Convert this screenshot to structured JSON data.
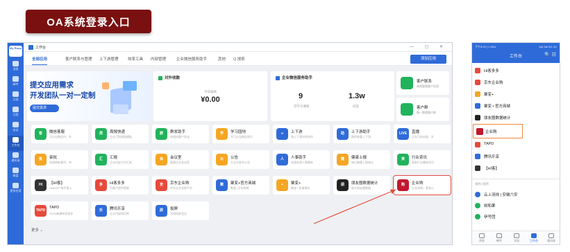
{
  "slide_title": "OA系统登录入口",
  "desktop": {
    "logo_text": "My Roup",
    "window_title": "工作台",
    "window_controls": "— ▢ ✕",
    "rail": [
      {
        "label": "消息",
        "icon": "chat-icon"
      },
      {
        "label": "邮件",
        "icon": "mail-icon"
      },
      {
        "label": "文档",
        "icon": "doc-icon"
      },
      {
        "label": "日程",
        "icon": "calendar-icon"
      },
      {
        "label": "会议",
        "icon": "meeting-icon"
      },
      {
        "label": "工作台",
        "icon": "grid-icon",
        "active": true
      },
      {
        "label": "通讯录",
        "icon": "contacts-icon"
      },
      {
        "label": "微盘",
        "icon": "disk-icon"
      },
      {
        "label": "更多应用",
        "icon": "apps-icon"
      }
    ],
    "tabs": [
      "全部应用",
      "客户联系与管理",
      "上下游管理",
      "效率工具",
      "内部管理",
      "企业微信服务助手",
      "其他"
    ],
    "search_label": "Q 搜索",
    "add_app_label": "添加应用",
    "banner": {
      "line1": "提交应用需求",
      "line2": "开发团队一对一定制",
      "button": "提交需求"
    },
    "card_receipts": {
      "title": "对外收款",
      "label": "今日收款",
      "value": "¥0.00"
    },
    "card_service": {
      "title": "企业微信服务助手",
      "v1": "9",
      "l1": "可学习课程",
      "v2": "1.3w",
      "l2": "问答"
    },
    "side_items": [
      {
        "name": "客户联系",
        "desc": "高效管理客户信息"
      },
      {
        "name": "客户群",
        "desc": "统一管理客户群"
      }
    ],
    "apps": [
      {
        "name": "微信客服",
        "desc": "可以在微信内、外",
        "color": "#21b35c",
        "glyph": "客"
      },
      {
        "name": "周报快递",
        "desc": "企业可到周报模板",
        "color": "#21b35c",
        "glyph": "周"
      },
      {
        "name": "群发助手",
        "desc": "快速向客户发送",
        "color": "#21b35c",
        "glyph": "群"
      },
      {
        "name": "学习园地",
        "desc": "学习企业微信知识",
        "color": "#f5a623",
        "glyph": "学"
      },
      {
        "name": "上下游",
        "desc": "和上下游伙伴协作",
        "color": "#2f6bd8",
        "glyph": "∞"
      },
      {
        "name": "上下游助手",
        "desc": "随时查看上下游",
        "color": "#2f6bd8",
        "glyph": "助"
      },
      {
        "name": "直播",
        "desc": "企业可向内部、外",
        "color": "#2f6bd8",
        "glyph": "LIVE"
      },
      {
        "name": "审批",
        "desc": "快速审批事项、申",
        "color": "#f5a623",
        "glyph": "批"
      },
      {
        "name": "汇报",
        "desc": "企业内部工作汇报",
        "color": "#21b35c",
        "glyph": "汇"
      },
      {
        "name": "会议室",
        "desc": "管理企业会议室",
        "color": "#f5a623",
        "glyph": "会"
      },
      {
        "name": "公告",
        "desc": "企业内发布公告",
        "color": "#f5a623",
        "glyph": "公"
      },
      {
        "name": "人事助手",
        "desc": "快速处理人事事务",
        "color": "#2f6bd8",
        "glyph": "人"
      },
      {
        "name": "健康上报",
        "desc": "每日健康上报统计",
        "color": "#f5a623",
        "glyph": "健"
      },
      {
        "name": "行业资讯",
        "desc": "获取行业最新资讯",
        "color": "#21b35c",
        "glyph": "资"
      },
      {
        "name": "【HI客】",
        "desc": "ChatGPT助手接入",
        "color": "#333333",
        "glyph": "HI"
      },
      {
        "name": "Hi客多多",
        "desc": "为客户提供智能",
        "color": "#e64a3b",
        "glyph": "多"
      },
      {
        "name": "京东企业购",
        "desc": "京东企业采购平台",
        "color": "#e64a3b",
        "glyph": "京"
      },
      {
        "name": "聚变+官方商城",
        "desc": "聚变+企业商城",
        "color": "#2f6bd8",
        "glyph": "聚"
      },
      {
        "name": "聚变+",
        "desc": "聚变+ 私域增长",
        "color": "#f5a623",
        "glyph": "+"
      },
      {
        "name": "朋友圈数据统计",
        "desc": "统计朋友圈数据",
        "color": "#222222",
        "glyph": "朋"
      },
      {
        "name": "企业购",
        "desc": "企业采购，更省心",
        "color": "#c0182d",
        "glyph": "购",
        "highlight": true
      },
      {
        "name": "TAPD",
        "desc": "TAPD敏捷研发协作",
        "color": "#e64a3b",
        "glyph": "TAPD"
      },
      {
        "name": "腾讯乐享",
        "desc": "企业内部知识库",
        "color": "#2f6bd8",
        "glyph": "乐"
      },
      {
        "name": "投屏",
        "desc": "无线投屏会议",
        "color": "#2f6bd8",
        "glyph": "屏"
      }
    ],
    "more_label": "更多 ⌄"
  },
  "phone": {
    "status_left": "下午5:29 | 1.9K/s",
    "status_right": "Sal Sal 5G 4G",
    "title": "工作台",
    "header_icons": "🔍 ☷",
    "items": [
      {
        "name": "Hi客多多",
        "color": "#e64a3b"
      },
      {
        "name": "京东企业购",
        "color": "#e64a3b"
      },
      {
        "name": "聚变+",
        "color": "#f5a623"
      },
      {
        "name": "聚变 • 官方商城",
        "color": "#2f6bd8"
      },
      {
        "name": "朋友圈数据统计",
        "color": "#222222"
      },
      {
        "name": "企业购",
        "color": "#c0182d",
        "highlight": true
      },
      {
        "name": "TAPD",
        "color": "#e64a3b"
      },
      {
        "name": "腾讯乐享",
        "color": "#2f6bd8"
      },
      {
        "name": "【HI客】",
        "color": "#333333"
      }
    ],
    "section_label": "我的小程序",
    "mini_programs": [
      {
        "name": "云上羽线 | 安徽六安",
        "color": "#2f6bd8"
      },
      {
        "name": "树和果",
        "color": "#21b35c"
      },
      {
        "name": "伊号团",
        "color": "#21b35c"
      }
    ],
    "nav": [
      {
        "label": "消息"
      },
      {
        "label": "邮件"
      },
      {
        "label": "文档"
      },
      {
        "label": "工作台",
        "active": true
      },
      {
        "label": "通讯录"
      }
    ]
  },
  "colors": {
    "brand": "#2f6bd8",
    "title_bg": "#7a1010",
    "highlight_red": "#e64a3b",
    "highlight_orange": "#f0863a"
  }
}
